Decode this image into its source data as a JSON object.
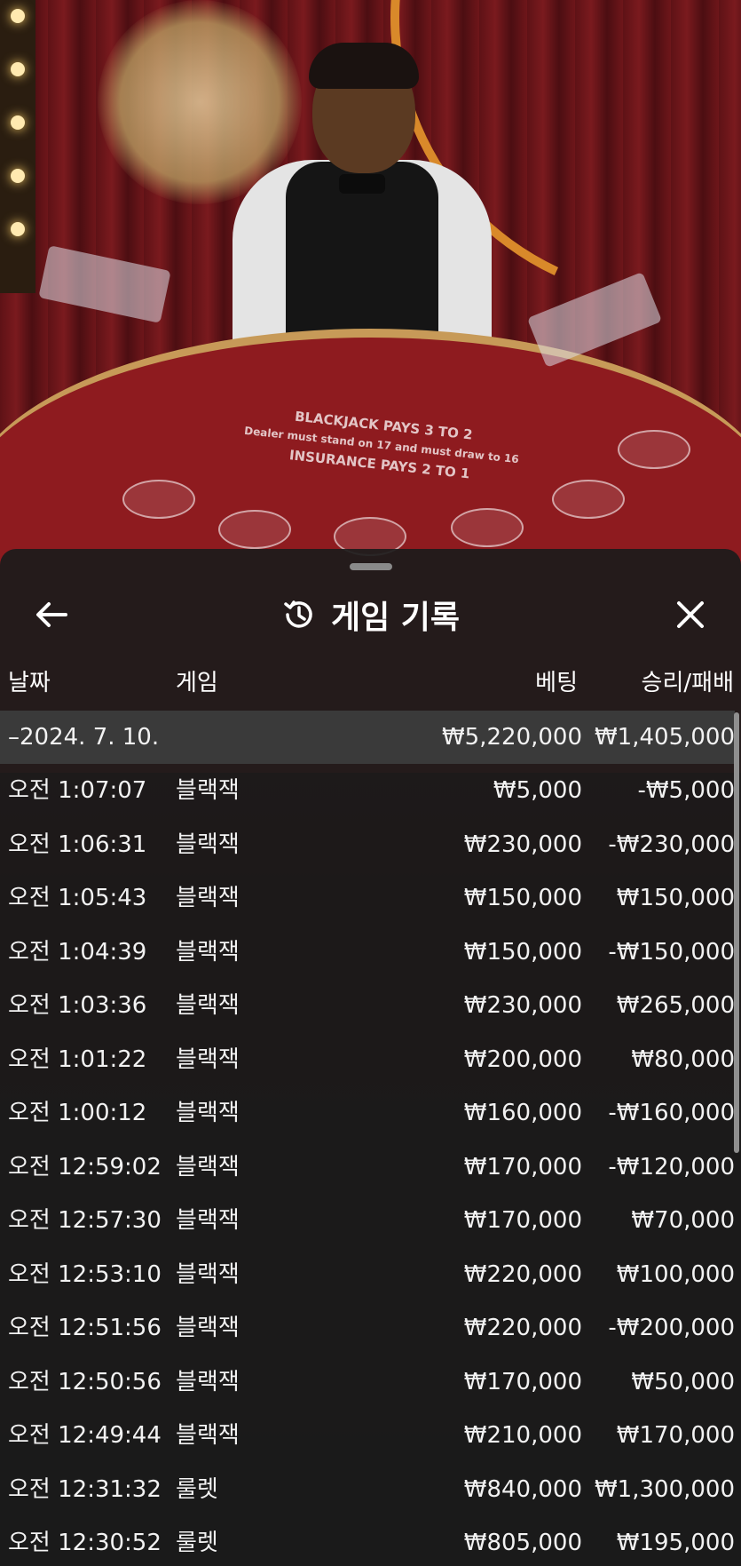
{
  "header": {
    "title": "게임 기록",
    "back_icon": "arrow-left-icon",
    "history_icon": "history-clock-icon",
    "close_icon": "close-icon"
  },
  "columns": {
    "date": "날짜",
    "game": "게임",
    "bet": "베팅",
    "result": "승리/패배"
  },
  "summary": {
    "date": "–2024. 7. 10.",
    "bet": "₩5,220,000",
    "result": "₩1,405,000"
  },
  "rows": [
    {
      "time": "오전 1:07:07",
      "game": "블랙잭",
      "bet": "₩5,000",
      "result": "-₩5,000"
    },
    {
      "time": "오전 1:06:31",
      "game": "블랙잭",
      "bet": "₩230,000",
      "result": "-₩230,000"
    },
    {
      "time": "오전 1:05:43",
      "game": "블랙잭",
      "bet": "₩150,000",
      "result": "₩150,000"
    },
    {
      "time": "오전 1:04:39",
      "game": "블랙잭",
      "bet": "₩150,000",
      "result": "-₩150,000"
    },
    {
      "time": "오전 1:03:36",
      "game": "블랙잭",
      "bet": "₩230,000",
      "result": "₩265,000"
    },
    {
      "time": "오전 1:01:22",
      "game": "블랙잭",
      "bet": "₩200,000",
      "result": "₩80,000"
    },
    {
      "time": "오전 1:00:12",
      "game": "블랙잭",
      "bet": "₩160,000",
      "result": "-₩160,000"
    },
    {
      "time": "오전 12:59:02",
      "game": "블랙잭",
      "bet": "₩170,000",
      "result": "-₩120,000"
    },
    {
      "time": "오전 12:57:30",
      "game": "블랙잭",
      "bet": "₩170,000",
      "result": "₩70,000"
    },
    {
      "time": "오전 12:53:10",
      "game": "블랙잭",
      "bet": "₩220,000",
      "result": "₩100,000"
    },
    {
      "time": "오전 12:51:56",
      "game": "블랙잭",
      "bet": "₩220,000",
      "result": "-₩200,000"
    },
    {
      "time": "오전 12:50:56",
      "game": "블랙잭",
      "bet": "₩170,000",
      "result": "₩50,000"
    },
    {
      "time": "오전 12:49:44",
      "game": "블랙잭",
      "bet": "₩210,000",
      "result": "₩170,000"
    },
    {
      "time": "오전 12:31:32",
      "game": "룰렛",
      "bet": "₩840,000",
      "result": "₩1,300,000"
    },
    {
      "time": "오전 12:30:52",
      "game": "룰렛",
      "bet": "₩805,000",
      "result": "₩195,000"
    }
  ],
  "table_text": {
    "line1": "BLACKJACK PAYS 3 TO 2",
    "line2": "Dealer must stand on 17 and must draw to 16",
    "line3": "INSURANCE PAYS 2 TO 1"
  },
  "colors": {
    "sheet_bg": "#1b1b1b",
    "summary_row_bg": "#3a3a3a",
    "table_felt": "#8e1b1f"
  }
}
